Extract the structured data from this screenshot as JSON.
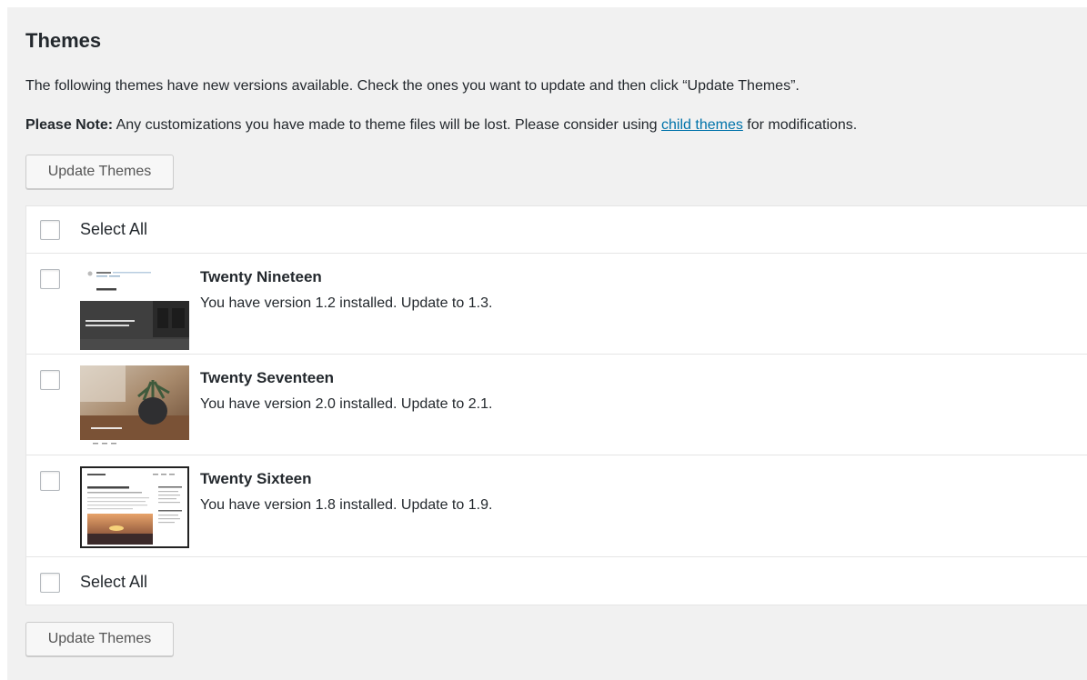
{
  "page": {
    "title": "Themes",
    "intro": "The following themes have new versions available. Check the ones you want to update and then click “Update Themes”.",
    "note_label": "Please Note:",
    "note_text_before": " Any customizations you have made to theme files will be lost. Please consider using ",
    "note_link": "child themes",
    "note_text_after": " for modifications."
  },
  "buttons": {
    "update_top": "Update Themes",
    "update_bottom": "Update Themes"
  },
  "table": {
    "select_all_top": "Select All",
    "select_all_bottom": "Select All",
    "themes": [
      {
        "name": "Twenty Nineteen",
        "description": "You have version 1.2 installed. Update to 1.3."
      },
      {
        "name": "Twenty Seventeen",
        "description": "You have version 2.0 installed. Update to 2.1."
      },
      {
        "name": "Twenty Sixteen",
        "description": "You have version 1.8 installed. Update to 1.9."
      }
    ]
  },
  "colors": {
    "panel_bg": "#f1f1f1",
    "link": "#0073aa",
    "text": "#23282d"
  }
}
